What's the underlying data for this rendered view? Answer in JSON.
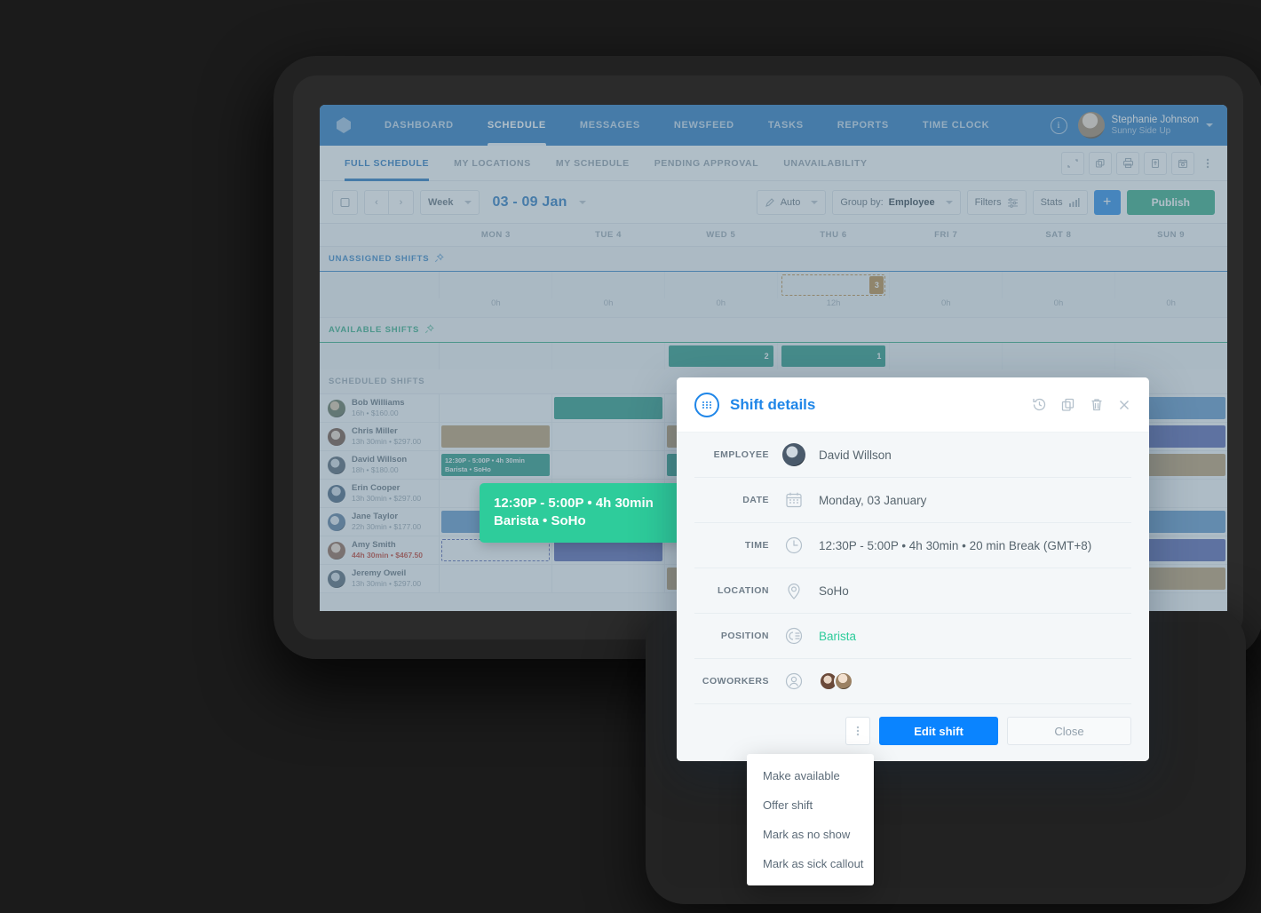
{
  "topnav": {
    "items": [
      {
        "label": "DASHBOARD",
        "active": false
      },
      {
        "label": "SCHEDULE",
        "active": true
      },
      {
        "label": "MESSAGES",
        "active": false
      },
      {
        "label": "NEWSFEED",
        "active": false
      },
      {
        "label": "TASKS",
        "active": false
      },
      {
        "label": "REPORTS",
        "active": false
      },
      {
        "label": "TIME CLOCK",
        "active": false
      }
    ],
    "info_badge": "i",
    "user": {
      "name": "Stephanie Johnson",
      "org": "Sunny Side Up"
    }
  },
  "subnav": {
    "items": [
      {
        "label": "FULL SCHEDULE",
        "active": true
      },
      {
        "label": "MY LOCATIONS",
        "active": false
      },
      {
        "label": "MY SCHEDULE",
        "active": false
      },
      {
        "label": "PENDING APPROVAL",
        "active": false
      },
      {
        "label": "UNAVAILABILITY",
        "active": false
      }
    ],
    "icons": [
      "expand-icon",
      "copy-icon",
      "print-icon",
      "export-icon",
      "calendar-sync-icon",
      "more-vertical-icon"
    ]
  },
  "toolbar": {
    "view_label": "Week",
    "date_range": "03 - 09 Jan",
    "auto_label": "Auto",
    "group_by_label": "Group by:",
    "group_by_value": "Employee",
    "filters_label": "Filters",
    "stats_label": "Stats",
    "add_label": "+",
    "publish_label": "Publish"
  },
  "days": [
    "MON 3",
    "TUE 4",
    "WED 5",
    "THU 6",
    "FRI 7",
    "SAT 8",
    "SUN 9"
  ],
  "sections": {
    "unassigned_title": "UNASSIGNED SHIFTS",
    "available_title": "AVAILABLE SHIFTS",
    "scheduled_title": "SCHEDULED SHIFTS"
  },
  "unassigned": {
    "chips": [
      {
        "day": 3,
        "count": "3",
        "style": "dashed-orange"
      }
    ],
    "hours": [
      "0h",
      "0h",
      "0h",
      "12h",
      "0h",
      "0h",
      "0h"
    ]
  },
  "available": {
    "chips": [
      {
        "day": 2,
        "count": "2",
        "style": "green"
      },
      {
        "day": 3,
        "count": "1",
        "style": "green"
      }
    ]
  },
  "employees": [
    {
      "name": "Bob Williams",
      "sub": "16h • $160.00",
      "over": false,
      "photo": "ph1",
      "shifts": [
        {
          "day": 1,
          "color": "green",
          "text": ""
        },
        {
          "day": 6,
          "color": "blue",
          "text": ""
        }
      ]
    },
    {
      "name": "Chris Miller",
      "sub": "13h 30min • $297.00",
      "over": false,
      "photo": "ph2",
      "shifts": [
        {
          "day": 0,
          "color": "tan",
          "text": ""
        },
        {
          "day": 2,
          "color": "tan",
          "text": ""
        },
        {
          "day": 6,
          "color": "indigo",
          "text": ""
        }
      ]
    },
    {
      "name": "David Willson",
      "sub": "18h • $180.00",
      "over": false,
      "photo": "ph3",
      "shifts": [
        {
          "day": 0,
          "color": "green",
          "text": "12:30P - 5:00P • 4h 30min\nBarista • SoHo"
        },
        {
          "day": 2,
          "color": "green",
          "text": ""
        },
        {
          "day": 6,
          "color": "tan",
          "text": ""
        }
      ]
    },
    {
      "name": "Erin Cooper",
      "sub": "13h 30min • $297.00",
      "over": false,
      "photo": "ph4",
      "shifts": []
    },
    {
      "name": "Jane Taylor",
      "sub": "22h 30min • $177.00",
      "over": false,
      "photo": "ph5",
      "shifts": [
        {
          "day": 0,
          "color": "blue",
          "text": ""
        },
        {
          "day": 2,
          "color": "blue",
          "text": ""
        },
        {
          "day": 6,
          "color": "blue",
          "text": ""
        }
      ]
    },
    {
      "name": "Amy Smith",
      "sub": "44h 30min • $467.50",
      "over": true,
      "photo": "ph6",
      "shifts": [
        {
          "day": 0,
          "color": "dashed-indigo",
          "text": ""
        },
        {
          "day": 1,
          "color": "indigo",
          "text": ""
        },
        {
          "day": 6,
          "color": "indigo",
          "text": ""
        }
      ]
    },
    {
      "name": "Jeremy Oweil",
      "sub": "13h 30min • $297.00",
      "over": false,
      "photo": "ph7",
      "shifts": [
        {
          "day": 2,
          "color": "tan",
          "text": ""
        },
        {
          "day": 6,
          "color": "tan",
          "text": ""
        }
      ]
    }
  ],
  "tooltip": {
    "line1": "12:30P - 5:00P • 4h 30min",
    "line2": "Barista • SoHo"
  },
  "modal": {
    "title": "Shift details",
    "head_icons": [
      "history-icon",
      "duplicate-icon",
      "trash-icon",
      "close-icon"
    ],
    "rows": [
      {
        "label": "EMPLOYEE",
        "icon": "avatar-icon",
        "value": "David Willson",
        "green": false,
        "kind": "avatar"
      },
      {
        "label": "DATE",
        "icon": "calendar-icon",
        "value": "Monday, 03 January",
        "green": false,
        "kind": "text"
      },
      {
        "label": "TIME",
        "icon": "clock-icon",
        "value": "12:30P - 5:00P • 4h 30min • 20 min Break (GMT+8)",
        "green": false,
        "kind": "text"
      },
      {
        "label": "LOCATION",
        "icon": "map-pin-icon",
        "value": "SoHo",
        "green": false,
        "kind": "text"
      },
      {
        "label": "POSITION",
        "icon": "position-icon",
        "value": "Barista",
        "green": true,
        "kind": "text"
      },
      {
        "label": "COWORKERS",
        "icon": "person-icon",
        "value": "",
        "green": false,
        "kind": "coworkers"
      }
    ],
    "footer": {
      "kebab_label": "⋮",
      "edit_label": "Edit shift",
      "close_label": "Close"
    }
  },
  "dropdown": {
    "items": [
      "Make available",
      "Offer shift",
      "Mark as no show",
      "Mark as sick callout"
    ]
  },
  "colors": {
    "brand_blue": "#1f72bd",
    "action_blue": "#0a84ff",
    "publish_green": "#2aa77f",
    "tooltip_green": "#2ecc9b",
    "shift_tan": "#b99a6b",
    "shift_green": "#1f9480",
    "shift_blue": "#5b93c9",
    "shift_indigo": "#515fae",
    "over_red": "#c0392b"
  }
}
